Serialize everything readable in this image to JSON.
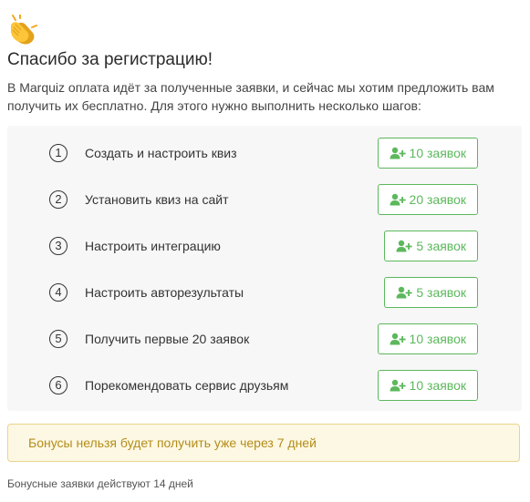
{
  "header": {
    "emoji_icon": "clapping-hands-icon",
    "title": "Спасибо за регистрацию!",
    "intro": "В Marquiz оплата идёт за полученные заявки, и сейчас мы хотим предложить вам получить их бесплатно. Для этого нужно выполнить несколько шагов:"
  },
  "steps": [
    {
      "number": "1",
      "label": "Создать и настроить квиз",
      "reward": "10 заявок"
    },
    {
      "number": "2",
      "label": "Установить квиз на сайт",
      "reward": "20 заявок"
    },
    {
      "number": "3",
      "label": "Настроить интеграцию",
      "reward": "5 заявок"
    },
    {
      "number": "4",
      "label": "Настроить авторезультаты",
      "reward": "5 заявок"
    },
    {
      "number": "5",
      "label": "Получить первые 20 заявок",
      "reward": "10 заявок"
    },
    {
      "number": "6",
      "label": "Порекомендовать сервис друзьям",
      "reward": "10 заявок"
    }
  ],
  "reward_icon": "user-plus-icon",
  "notice": {
    "text": "Бонусы нельзя будет получить уже через 7 дней"
  },
  "footnote": "Бонусные заявки действуют 14 дней",
  "colors": {
    "accent_green": "#5cb85c",
    "notice_bg": "#fcf8e3",
    "notice_text": "#b58c1a",
    "steps_bg": "#f7f7f7"
  }
}
